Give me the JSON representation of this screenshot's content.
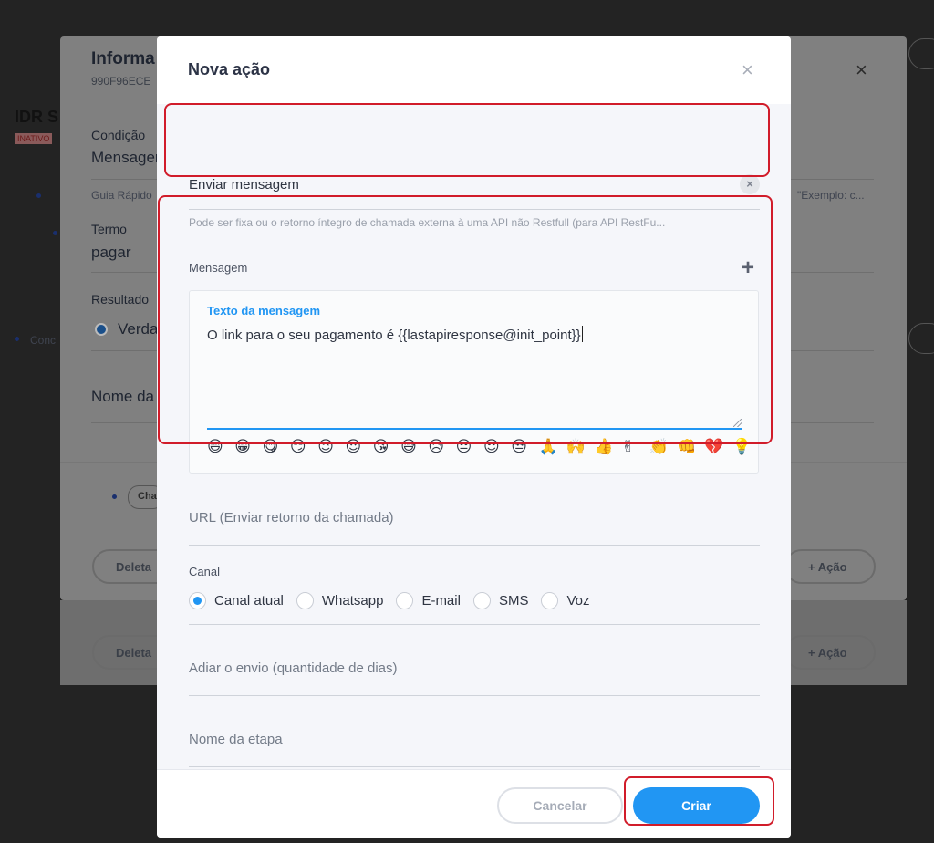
{
  "background": {
    "title": "Informa",
    "code": "990F96ECE",
    "close": "×",
    "left_title": "IDR S",
    "left_badge": "INATIVO",
    "condition_label": "Condição",
    "condition_value": "Mensager",
    "guide_text": "Guia Rápido",
    "term_label": "Termo",
    "term_value": "pagar",
    "result_label": "Resultado",
    "result_value": "Verda",
    "name_label": "Nome da",
    "chip_text": "Cha",
    "example_text": "\"Exemplo: c...",
    "conc_text": "Conc",
    "delete_label": "Deleta",
    "action_label": "+ Ação"
  },
  "modal": {
    "title": "Nova ação",
    "close": "×",
    "action_type": {
      "value": "Enviar mensagem",
      "clear": "×",
      "hint": "Pode ser fixa ou o retorno íntegro de chamada externa à uma API não Restfull (para API RestFu..."
    },
    "message": {
      "section_label": "Mensagem",
      "add": "+",
      "textarea_label": "Texto da mensagem",
      "text": "O link para o seu pagamento é {{lastapiresponse@init_point}}",
      "emojis": [
        "😄",
        "😁",
        "😋",
        "😏",
        "😉",
        "😍",
        "😘",
        "😅",
        "😥",
        "😔",
        "😌",
        "😒",
        "🙏",
        "🙌",
        "👍",
        "✌",
        "👏",
        "👊",
        "💔",
        "💡"
      ]
    },
    "url_field": {
      "placeholder": "URL (Enviar retorno da chamada)"
    },
    "channel": {
      "label": "Canal",
      "options": [
        {
          "label": "Canal atual",
          "selected": true
        },
        {
          "label": "Whatsapp",
          "selected": false
        },
        {
          "label": "E-mail",
          "selected": false
        },
        {
          "label": "SMS",
          "selected": false
        },
        {
          "label": "Voz",
          "selected": false
        }
      ]
    },
    "delay_field": {
      "placeholder": "Adiar o envio (quantidade de dias)"
    },
    "step_name_field": {
      "placeholder": "Nome da etapa"
    },
    "footer": {
      "cancel": "Cancelar",
      "create": "Criar"
    }
  },
  "colors": {
    "accent": "#2196f3",
    "highlight": "#d11c2a",
    "overlay": "#232323"
  }
}
